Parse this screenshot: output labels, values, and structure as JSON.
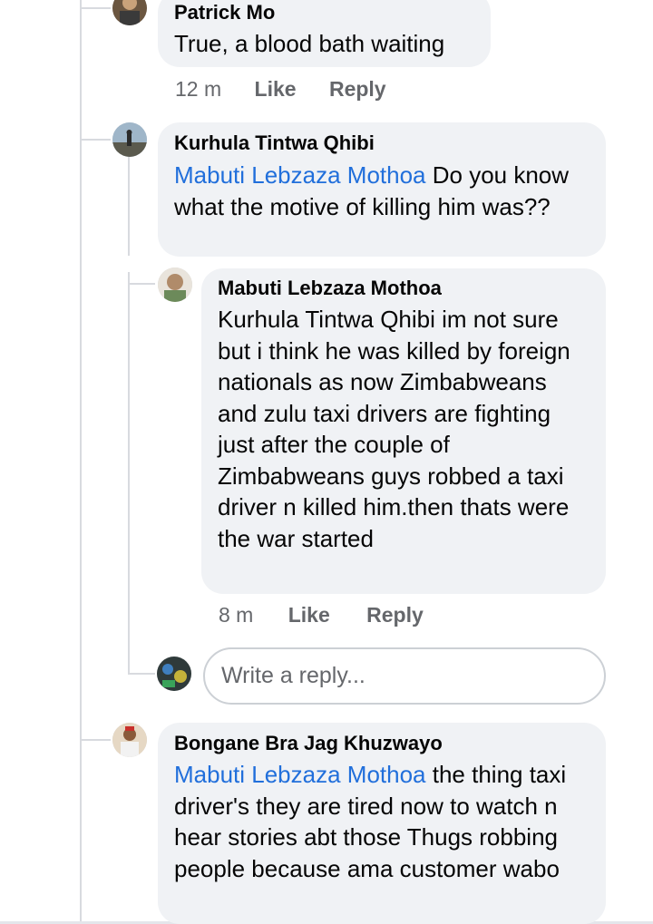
{
  "comments": [
    {
      "author": "Patrick Mo",
      "mention": "",
      "text": "True, a blood bath waiting",
      "time": "12 m",
      "like_label": "Like",
      "reply_label": "Reply"
    },
    {
      "author": "Kurhula Tintwa Qhibi",
      "mention": "Mabuti Lebzaza Mothoa",
      "text": " Do you know what the motive of killing him was??"
    },
    {
      "author": "Mabuti Lebzaza Mothoa",
      "mention": "Kurhula Tintwa Qhibi",
      "text": " im not sure but i think he was killed by foreign nationals as now Zimbabweans and zulu taxi drivers are fighting just after the couple of Zimbabweans guys robbed a taxi driver n killed him.then thats were the war started",
      "time": "8 m",
      "like_label": "Like",
      "reply_label": "Reply"
    },
    {
      "author": "Bongane Bra Jag Khuzwayo",
      "mention": "Mabuti Lebzaza Mothoa",
      "text": " the thing taxi driver's they are tired now to watch n hear stories abt those Thugs robbing people because ama customer wabo"
    }
  ],
  "reply_box": {
    "placeholder": "Write a reply..."
  },
  "colors": {
    "bubble": "#f0f2f5",
    "mention": "#216fdb",
    "meta": "#65676b",
    "thread_line": "#d8dadf"
  },
  "icons": [
    "avatar-patrick",
    "avatar-kurhula",
    "avatar-mabuti",
    "avatar-current-user",
    "avatar-bongane"
  ]
}
